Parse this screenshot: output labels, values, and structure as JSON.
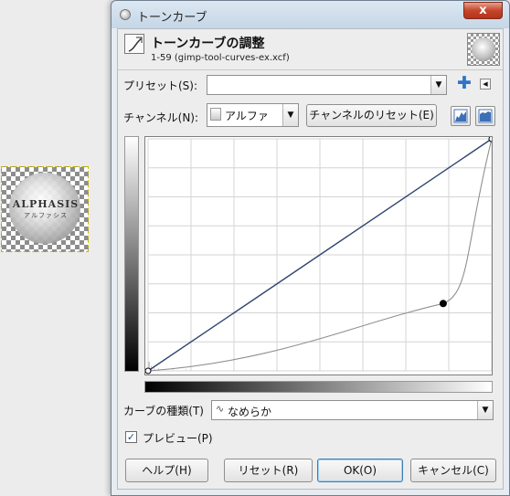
{
  "canvas": {
    "logo_text": "ALPHASIS",
    "logo_subtext": "アルファシス"
  },
  "window": {
    "title": "トーンカーブ",
    "close_glyph": "x"
  },
  "header": {
    "title": "トーンカーブの調整",
    "subtitle": "1-59 (gimp-tool-curves-ex.xcf)"
  },
  "presets": {
    "label": "プリセット(S):",
    "value": ""
  },
  "channel": {
    "label": "チャンネル(N):",
    "value": "アルファ",
    "reset_label": "チャンネルのリセット(E)"
  },
  "curve": {
    "points": [
      [
        0,
        0
      ],
      [
        255,
        255
      ]
    ],
    "alpha_points": [
      [
        0,
        0
      ],
      [
        219,
        74
      ],
      [
        255,
        255
      ]
    ]
  },
  "curve_type": {
    "label": "カーブの種類(T)",
    "value": "なめらか"
  },
  "preview": {
    "label": "プレビュー(P)",
    "checked": true
  },
  "buttons": {
    "help": "ヘルプ(H)",
    "reset": "リセット(R)",
    "ok": "OK(O)",
    "cancel": "キャンセル(C)"
  },
  "colors": {
    "linear_curve": "#2f4570",
    "smooth_curve": "#909090",
    "accent_plus": "#2e74c9"
  }
}
